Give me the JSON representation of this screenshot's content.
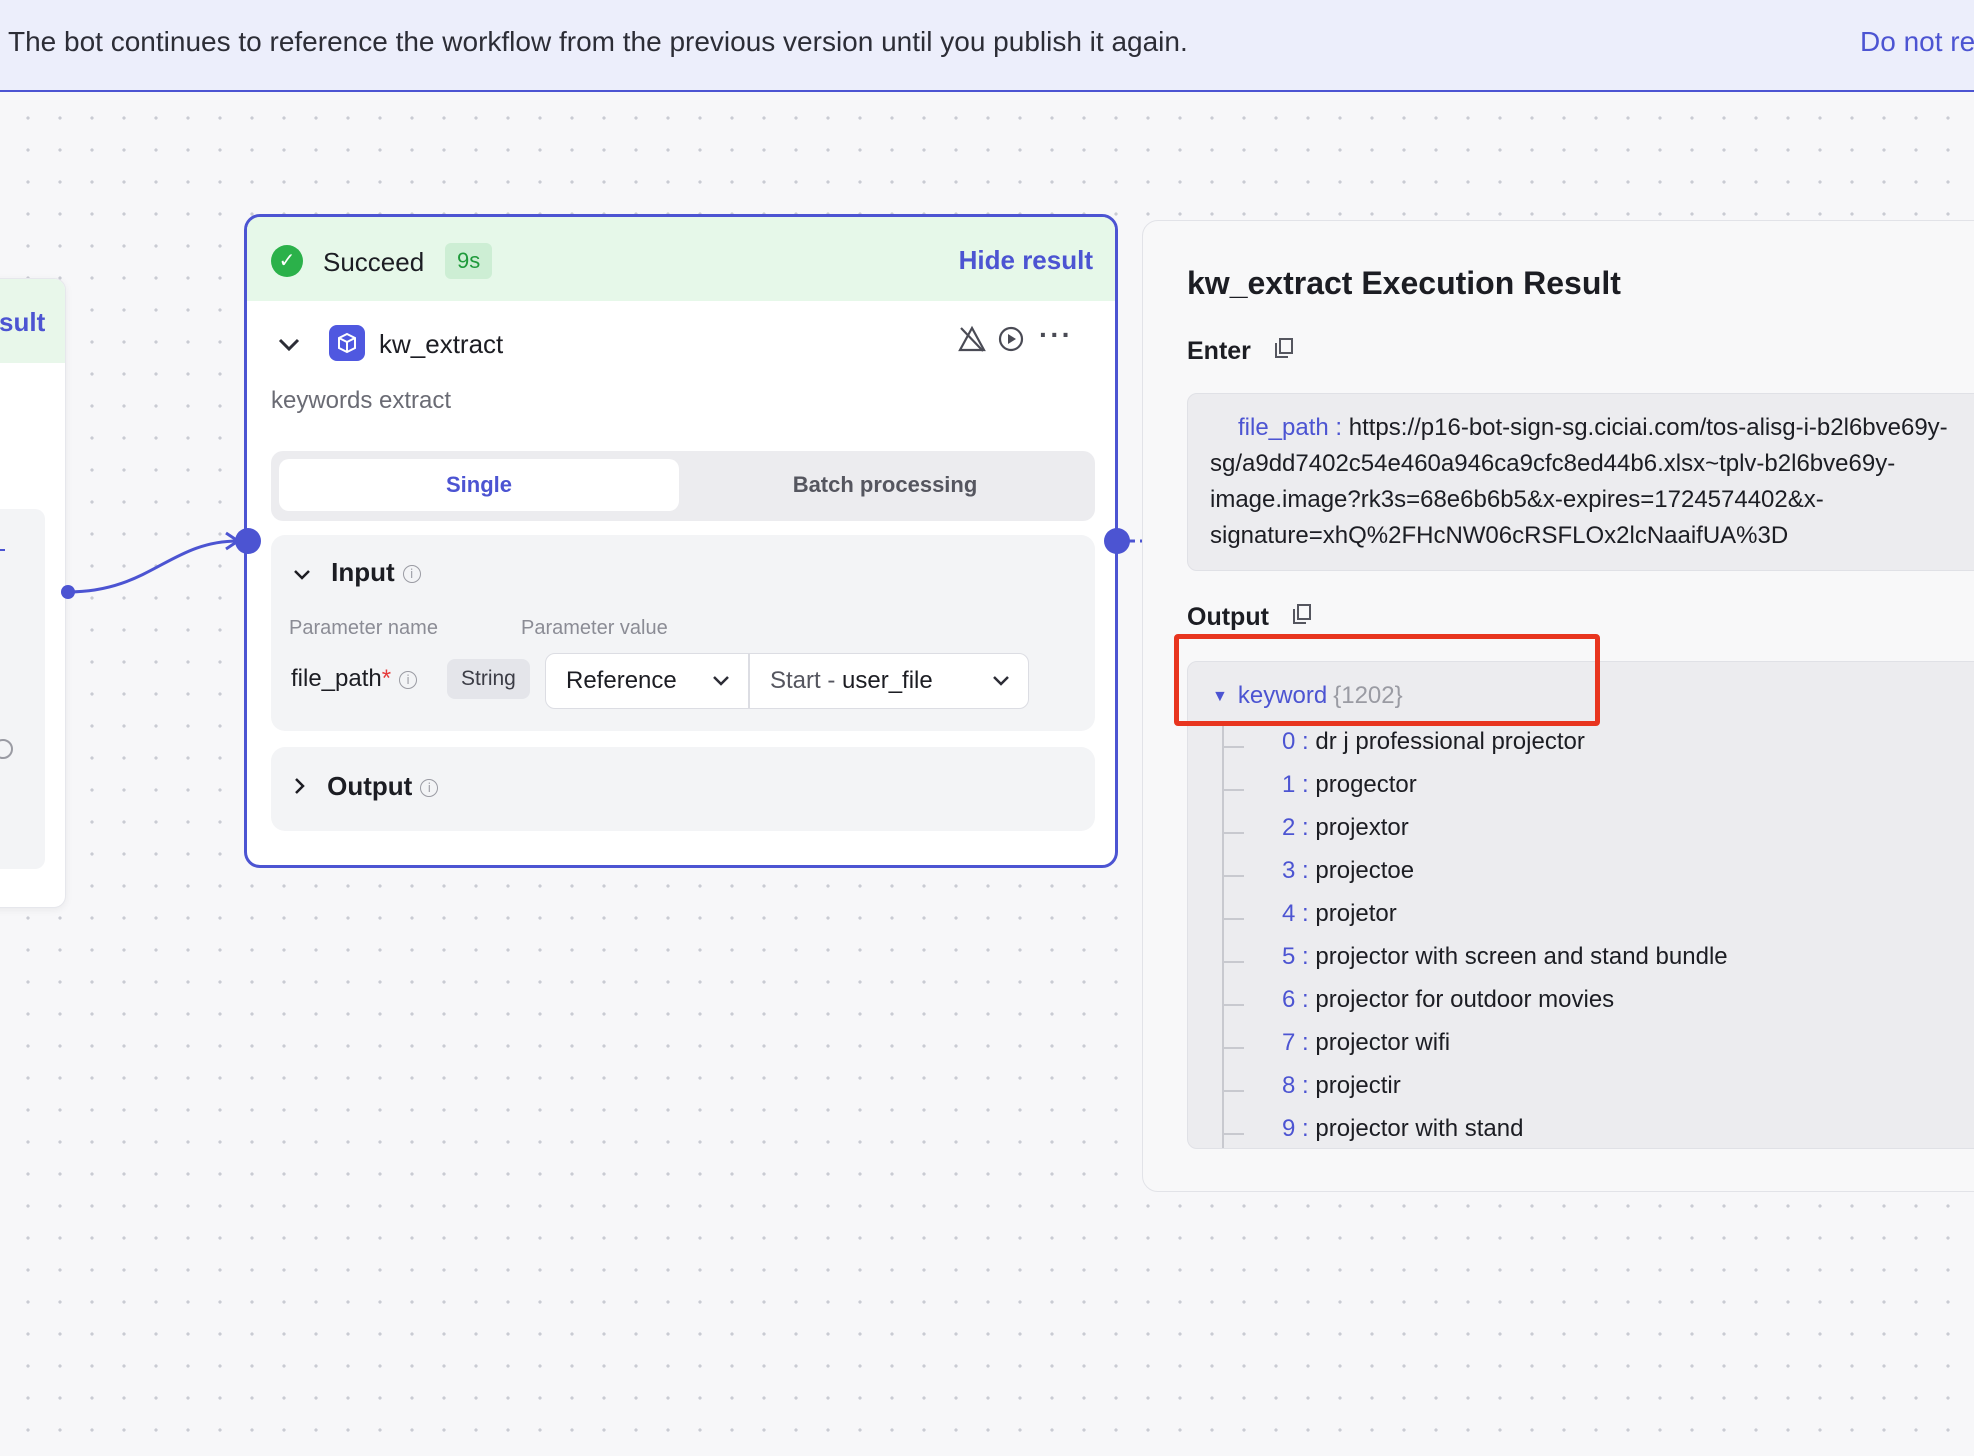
{
  "banner": {
    "message": "The bot continues to reference the workflow from the previous version until you publish it again.",
    "action": "Do not re"
  },
  "left_node": {
    "header_fragment": "sult"
  },
  "node": {
    "status": "Succeed",
    "duration": "9s",
    "hide_result": "Hide result",
    "name": "kw_extract",
    "description": "keywords extract",
    "tabs": [
      "Single",
      "Batch processing"
    ],
    "input": {
      "title": "Input",
      "col_name": "Parameter name",
      "col_value": "Parameter value",
      "param_name": "file_path",
      "required_mark": "*",
      "param_type": "String",
      "source_type": "Reference",
      "source_value_prefix": "Start - ",
      "source_value": "user_file"
    },
    "output": {
      "title": "Output"
    }
  },
  "result": {
    "title": "kw_extract Execution Result",
    "enter_label": "Enter",
    "enter": {
      "key": "file_path :",
      "lines": [
        "https://p16-bot-sign-sg.ciciai.com/tos-alisg-i-b2l6bve69y-",
        "sg/a9dd7402c54e460a946ca9cfc8ed44b6.xlsx~tplv-b2l6bve69y-",
        "image.image?rk3s=68e6b6b5&x-expires=1724574402&x-",
        "signature=xhQ%2FHcNW06cRSFLOx2lcNaaifUA%3D"
      ]
    },
    "output_label": "Output",
    "output": {
      "key": "keyword",
      "count": "{1202}",
      "items": [
        {
          "index": "0",
          "value": "dr j professional projector"
        },
        {
          "index": "1",
          "value": "progector"
        },
        {
          "index": "2",
          "value": "projextor"
        },
        {
          "index": "3",
          "value": "projectoe"
        },
        {
          "index": "4",
          "value": "projetor"
        },
        {
          "index": "5",
          "value": "projector with screen and stand bundle"
        },
        {
          "index": "6",
          "value": "projector for outdoor movies"
        },
        {
          "index": "7",
          "value": "projector wifi"
        },
        {
          "index": "8",
          "value": "projectir"
        },
        {
          "index": "9",
          "value": "projector with stand"
        }
      ]
    }
  },
  "colors": {
    "accent": "#4c54d2",
    "success": "#2bb14a",
    "highlight_box": "#e8351f"
  }
}
